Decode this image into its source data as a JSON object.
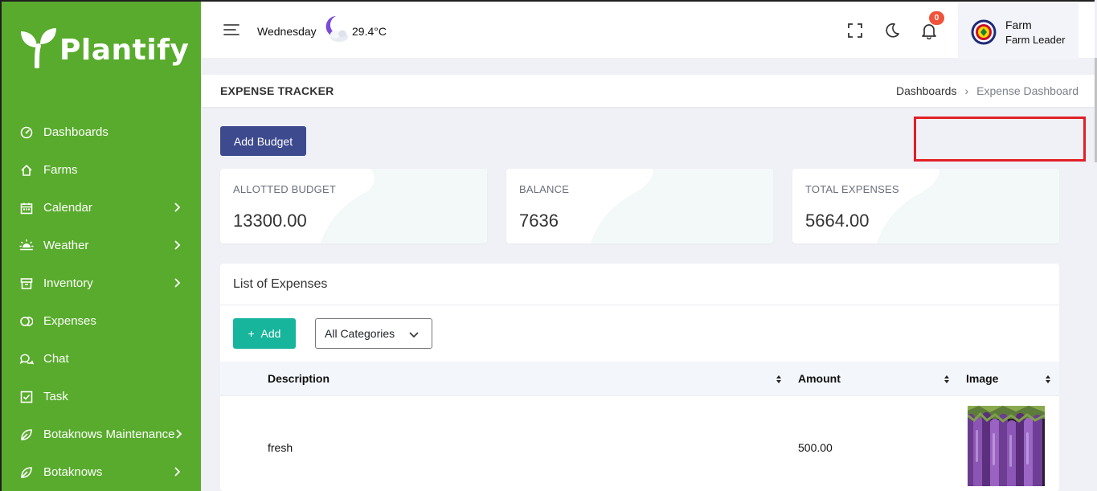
{
  "brand": {
    "name": "Plantify"
  },
  "sidebar": {
    "items": [
      {
        "label": "Dashboards",
        "icon": "gauge-icon",
        "has_submenu": false
      },
      {
        "label": "Farms",
        "icon": "home-icon",
        "has_submenu": false
      },
      {
        "label": "Calendar",
        "icon": "calendar-icon",
        "has_submenu": true
      },
      {
        "label": "Weather",
        "icon": "sun-icon",
        "has_submenu": true
      },
      {
        "label": "Inventory",
        "icon": "archive-icon",
        "has_submenu": true
      },
      {
        "label": "Expenses",
        "icon": "coins-icon",
        "has_submenu": false
      },
      {
        "label": "Chat",
        "icon": "chat-icon",
        "has_submenu": false
      },
      {
        "label": "Task",
        "icon": "checkbox-icon",
        "has_submenu": false
      },
      {
        "label": "Botaknows Maintenance",
        "icon": "leaf-icon",
        "has_submenu": true
      },
      {
        "label": "Botaknows",
        "icon": "leaf-icon",
        "has_submenu": true
      }
    ]
  },
  "topbar": {
    "weekday": "Wednesday",
    "weather_icon": "moon-cloud-icon",
    "temperature": "29.4°C",
    "notification_count": "0",
    "user": {
      "name": "Farm",
      "role": "Farm Leader"
    }
  },
  "page": {
    "title": "EXPENSE TRACKER",
    "breadcrumb": [
      "Dashboards",
      "Expense Dashboard"
    ],
    "add_budget_label": "Add Budget"
  },
  "cards": [
    {
      "label": "ALLOTTED BUDGET",
      "value": "13300.00"
    },
    {
      "label": "BALANCE",
      "value": "7636"
    },
    {
      "label": "TOTAL EXPENSES",
      "value": "5664.00"
    }
  ],
  "expenses": {
    "title": "List of Expenses",
    "add_label": "Add",
    "category_filter": "All Categories",
    "columns": [
      "Description",
      "Amount",
      "Image"
    ],
    "rows": [
      {
        "description": "fresh",
        "amount": "500.00",
        "image": "eggplant-photo"
      }
    ]
  },
  "colors": {
    "sidebar": "#58ab2c",
    "primary": "#3d4a8e",
    "accent": "#17b59c",
    "badge": "#f1523a",
    "highlight_box": "#e21f26"
  }
}
